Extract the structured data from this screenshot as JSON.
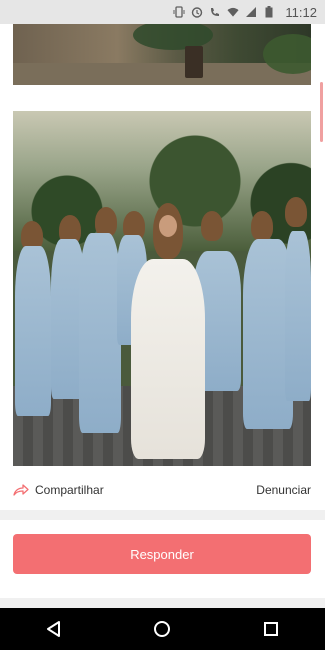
{
  "status_bar": {
    "time": "11:12",
    "icons": [
      "vibrate-icon",
      "alarm-icon",
      "wifi-call-icon",
      "wifi-icon",
      "signal-icon",
      "battery-icon"
    ]
  },
  "post": {
    "share_label": "Compartilhar",
    "report_label": "Denunciar",
    "reply_label": "Responder"
  },
  "nav": {
    "icons": [
      "back-icon",
      "home-icon",
      "recents-icon"
    ]
  },
  "colors": {
    "accent": "#f36f72",
    "status_bar_bg": "#e6e6e6",
    "nav_bar_bg": "#000000",
    "divider": "#f0f0f0"
  }
}
